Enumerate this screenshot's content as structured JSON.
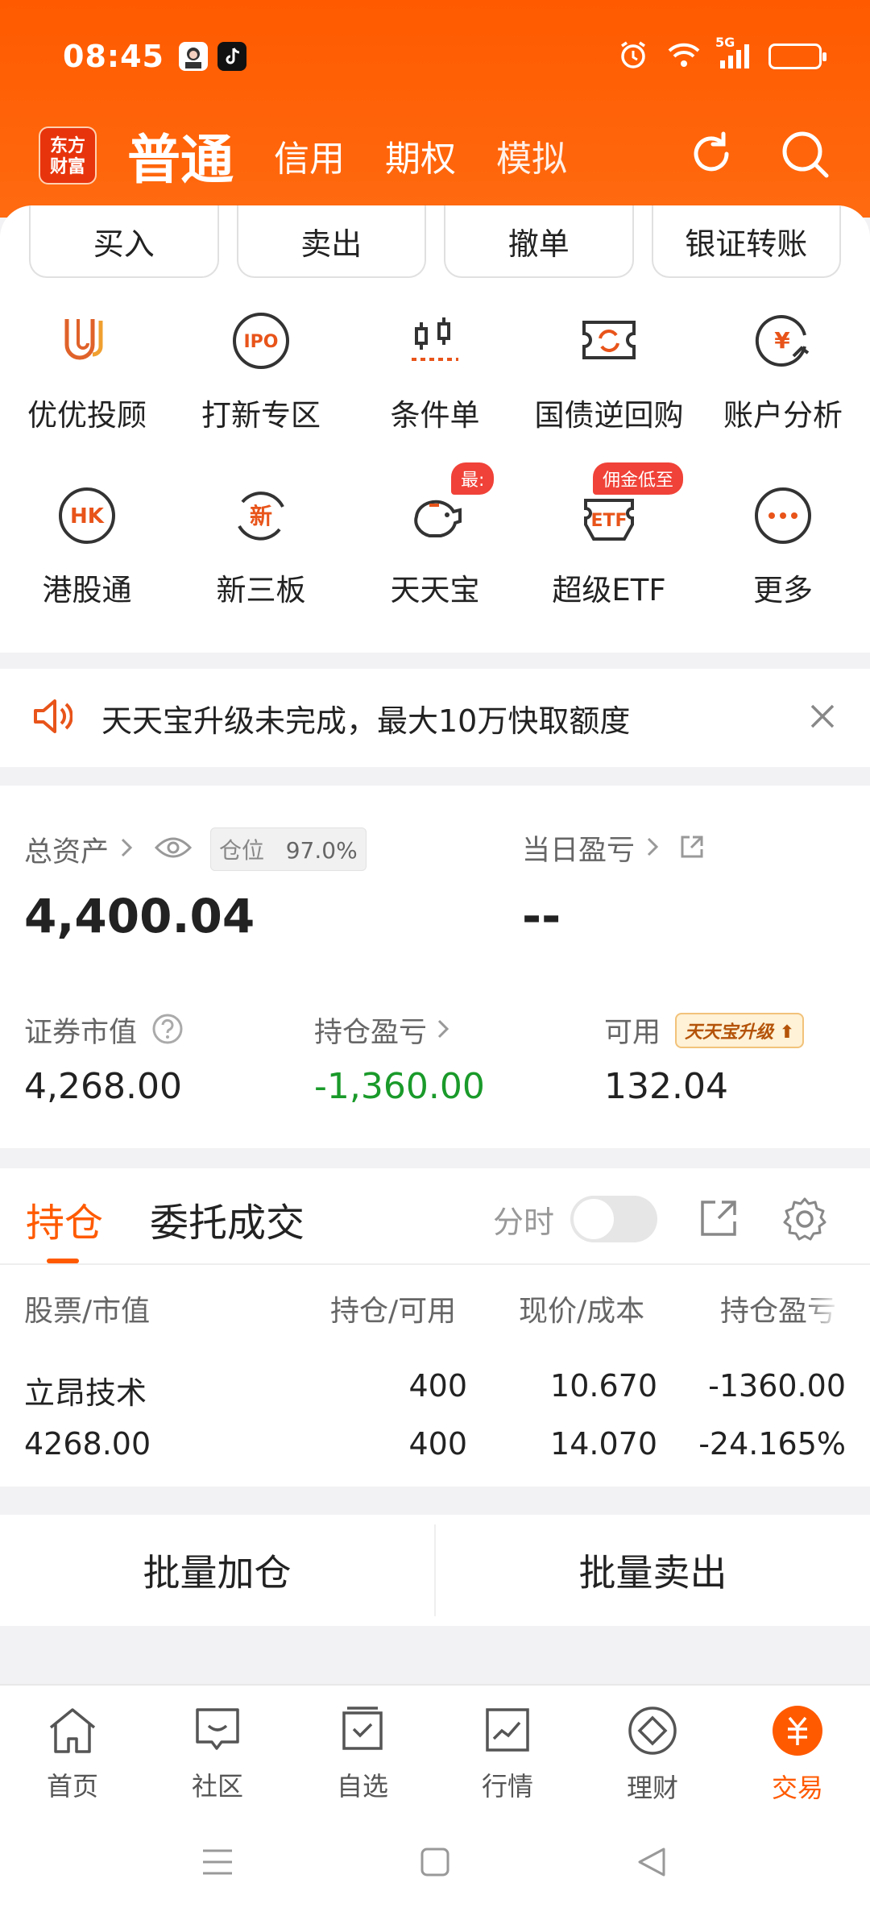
{
  "status": {
    "time": "08:45",
    "network": "5G"
  },
  "nav": {
    "logo": "东方\n财富",
    "tabs": [
      "普通",
      "信用",
      "期权",
      "模拟"
    ]
  },
  "quick_buttons": [
    "买入",
    "卖出",
    "撤单",
    "银证转账"
  ],
  "grid_row1": [
    {
      "label": "优优投顾",
      "icon": "uu-advisor-icon"
    },
    {
      "label": "打新专区",
      "icon": "ipo-icon",
      "glyph": "IPO"
    },
    {
      "label": "条件单",
      "icon": "candlestick-icon"
    },
    {
      "label": "国债逆回购",
      "icon": "bond-repo-icon"
    },
    {
      "label": "账户分析",
      "icon": "yen-analysis-icon",
      "glyph": "¥"
    }
  ],
  "grid_row2": [
    {
      "label": "港股通",
      "icon": "hk-icon",
      "glyph": "HK"
    },
    {
      "label": "新三板",
      "icon": "new-board-icon",
      "glyph": "新"
    },
    {
      "label": "天天宝",
      "icon": "piggy-bank-icon",
      "tag": "最:"
    },
    {
      "label": "超级ETF",
      "icon": "etf-icon",
      "glyph": "ETF",
      "tag": "佣金低至"
    },
    {
      "label": "更多",
      "icon": "more-icon"
    }
  ],
  "notice": {
    "text": "天天宝升级未完成，最大10万快取额度"
  },
  "assets": {
    "total_label": "总资产",
    "position_label": "仓位",
    "position_value": "97.0%",
    "total_value": "4,400.04",
    "daily_pl_label": "当日盈亏",
    "daily_pl_value": "--",
    "market_value_label": "证券市值",
    "market_value": "4,268.00",
    "holding_pl_label": "持仓盈亏",
    "holding_pl_value": "-1,360.00",
    "available_label": "可用",
    "available_badge": "天天宝升级",
    "available_value": "132.04"
  },
  "holdings": {
    "tab_active": "持仓",
    "tab_other": "委托成交",
    "intraday_label": "分时",
    "headers": [
      "股票/市值",
      "持仓/可用",
      "现价/成本",
      "持仓盈亏"
    ],
    "rows": [
      {
        "name": "立昂技术",
        "market_value": "4268.00",
        "position": "400",
        "available": "400",
        "price": "10.670",
        "cost": "14.070",
        "pl": "-1360.00",
        "pl_pct": "-24.165%"
      }
    ]
  },
  "batch": {
    "add": "批量加仓",
    "sell": "批量卖出"
  },
  "bottom_nav": [
    {
      "label": "首页",
      "icon": "home-icon"
    },
    {
      "label": "社区",
      "icon": "community-icon"
    },
    {
      "label": "自选",
      "icon": "watchlist-icon"
    },
    {
      "label": "行情",
      "icon": "market-icon"
    },
    {
      "label": "理财",
      "icon": "wealth-icon"
    },
    {
      "label": "交易",
      "icon": "trade-icon",
      "active": true
    }
  ],
  "colors": {
    "brand": "#ff5a00",
    "loss": "#1a9a2a",
    "tag": "#f04238"
  }
}
